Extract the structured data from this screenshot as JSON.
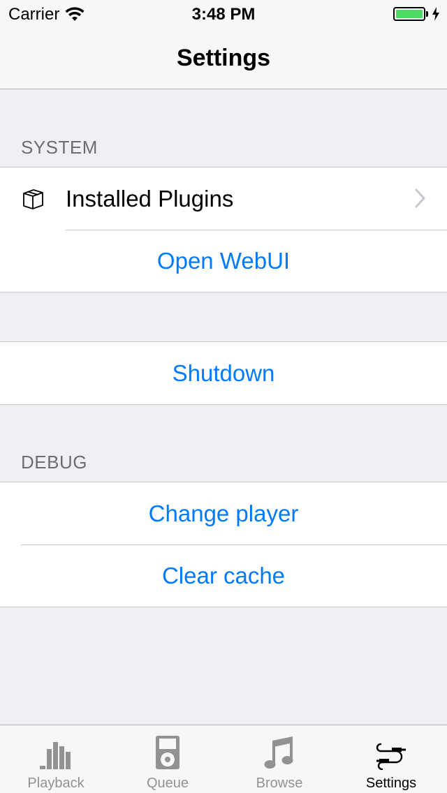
{
  "status_bar": {
    "carrier": "Carrier",
    "time": "3:48 PM",
    "battery_level": 1.0,
    "battery_color": "#4cd964",
    "icons": [
      "wifi-icon",
      "battery-icon",
      "charging-bolt-icon"
    ]
  },
  "nav": {
    "title": "Settings"
  },
  "sections": {
    "system": {
      "header": "SYSTEM",
      "rows": {
        "installed_plugins": {
          "label": "Installed Plugins",
          "icon": "box-icon",
          "accessory": "chevron-right-icon"
        },
        "open_webui": {
          "label": "Open WebUI"
        }
      }
    },
    "power": {
      "rows": {
        "shutdown": {
          "label": "Shutdown"
        }
      }
    },
    "debug": {
      "header": "DEBUG",
      "rows": {
        "change_player": {
          "label": "Change player"
        },
        "clear_cache": {
          "label": "Clear cache"
        }
      }
    }
  },
  "tabbar": {
    "tabs": [
      {
        "label": "Playback",
        "icon": "bar-chart-icon",
        "active": false
      },
      {
        "label": "Queue",
        "icon": "ipod-icon",
        "active": false
      },
      {
        "label": "Browse",
        "icon": "music-note-icon",
        "active": false
      },
      {
        "label": "Settings",
        "icon": "cable-icon",
        "active": true
      }
    ]
  },
  "colors": {
    "accent": "#007aff",
    "background": "#efeff4",
    "section_header": "#6d6d72",
    "tab_inactive": "#929292"
  }
}
